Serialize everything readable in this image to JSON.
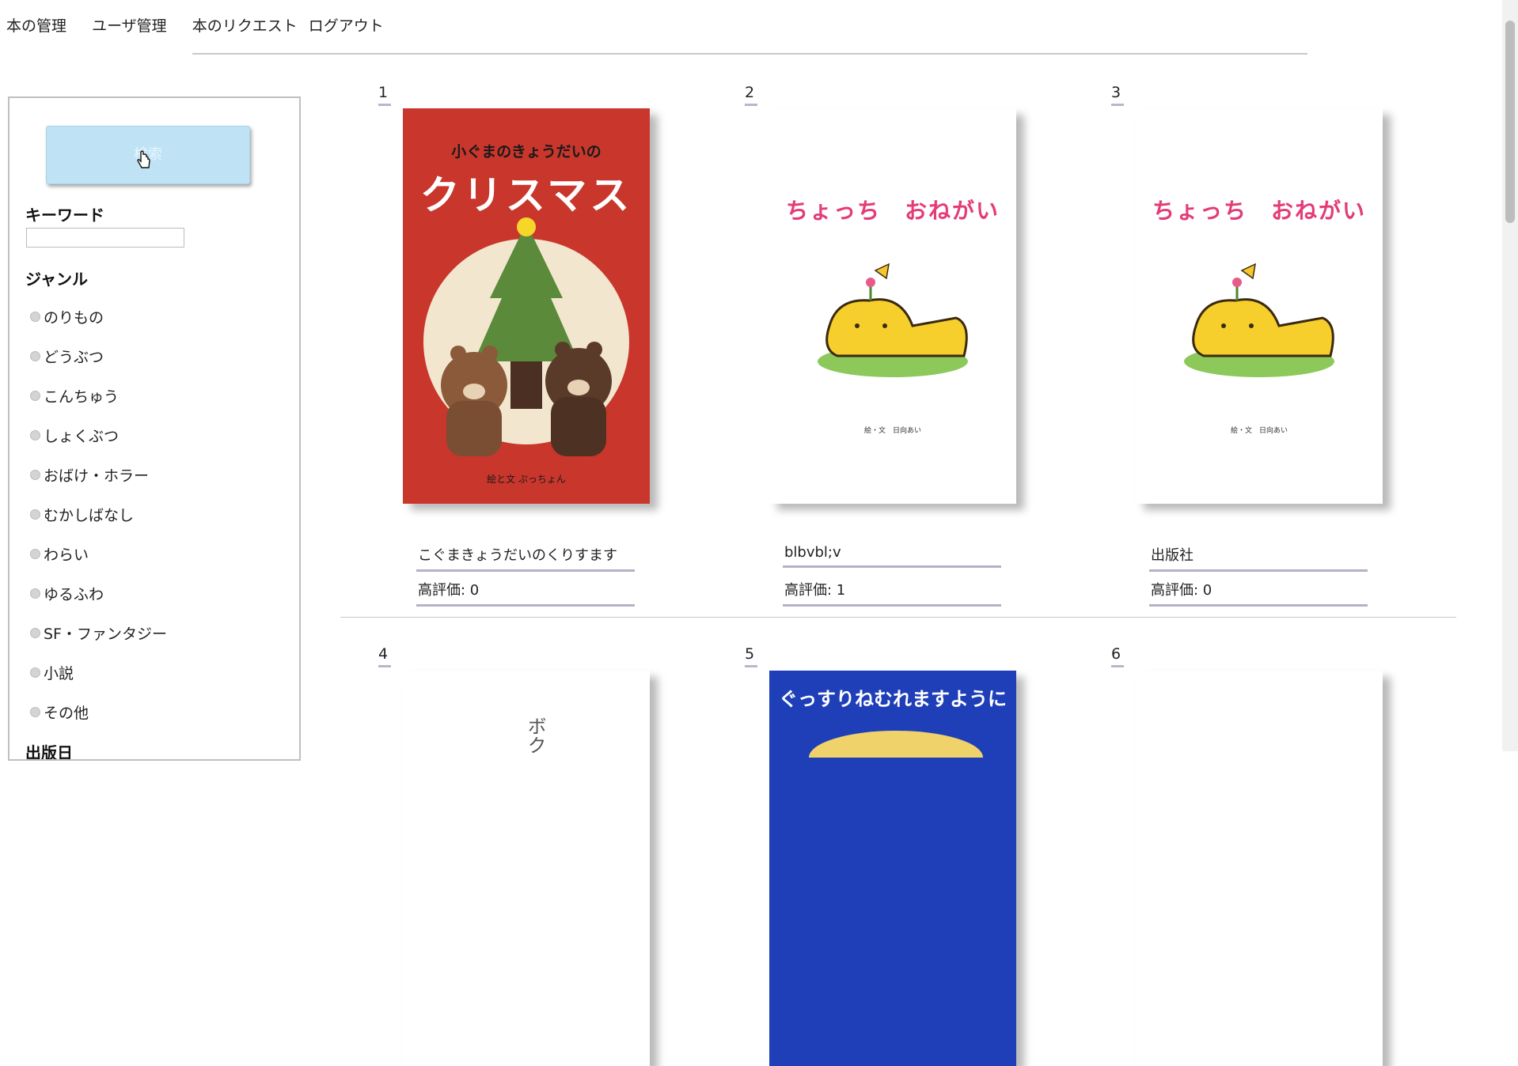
{
  "nav": {
    "items": [
      "本の管理",
      "ユーザ管理",
      "本のリクエスト",
      "ログアウト"
    ]
  },
  "sidebar": {
    "search_button": "検索",
    "keyword_label": "キーワード",
    "keyword_value": "",
    "genre_label": "ジャンル",
    "genres": [
      "のりもの",
      "どうぶつ",
      "こんちゅう",
      "しょくぶつ",
      "おばけ・ホラー",
      "むかしばなし",
      "わらい",
      "ゆるふわ",
      "SF・ファンタジー",
      "小説",
      "その他"
    ],
    "date_label": "出版日"
  },
  "books": [
    {
      "num": "1",
      "title": "こぐまきょうだいのくりすます",
      "rating": "高評価: 0",
      "cover_title_small": "小ぐまのきょうだいの",
      "cover_title_big": "クリスマス",
      "cover_credit": "絵と文 ぷっちょん"
    },
    {
      "num": "2",
      "title": "blbvbl;v",
      "rating": "高評価: 1",
      "cover_title": "ちょっち　おねがい",
      "cover_credit": "絵・文　日向あい"
    },
    {
      "num": "3",
      "title": "出版社",
      "rating": "高評価: 0",
      "cover_title": "ちょっち　おねがい",
      "cover_credit": "絵・文　日向あい"
    },
    {
      "num": "4",
      "cover_title": "ボク"
    },
    {
      "num": "5",
      "cover_title": "ぐっすりねむれますように"
    },
    {
      "num": "6"
    }
  ],
  "colors": {
    "accent_button": "#bfe3f5",
    "cover_red": "#c9362c",
    "cover_blue": "#1f3fb8",
    "title_pink": "#e43b78",
    "underline": "#b3b3c6"
  }
}
